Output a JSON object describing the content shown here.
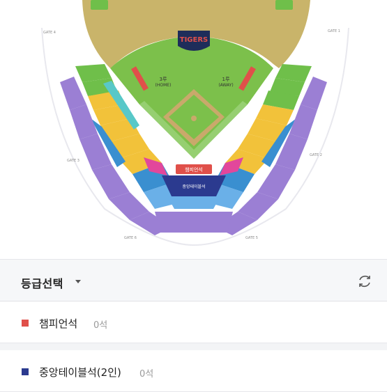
{
  "map": {
    "team_logo_text": "TIGERS",
    "home_label": "3루",
    "home_sub": "(HOME)",
    "away_label": "1루",
    "away_sub": "(AWAY)",
    "champion_label": "챔피언석",
    "central_label": "중앙테이블석",
    "gates": {
      "gate4": "GATE 4",
      "gate1": "GATE 1",
      "gate3": "GATE 3",
      "gate2": "GATE 2",
      "gate6": "GATE 6",
      "gate5": "GATE 5"
    },
    "colors": {
      "field": "#7cc04b",
      "stands": "#c9b46a",
      "outer": "#9b7fd4",
      "blue": "#3a8fd0",
      "yellow": "#f2c23a",
      "green": "#6fbf4a",
      "teal": "#58c8c8",
      "pink": "#e2479b",
      "navy": "#2b3a8f",
      "red": "#e0504a"
    }
  },
  "grade_select": {
    "title": "등급선택",
    "caret_icon": "caret-down-icon",
    "refresh_icon": "refresh-icon"
  },
  "seat_grades": [
    {
      "name": "챔피언석",
      "count": "0석",
      "color": "#e0504a"
    },
    {
      "name": "중앙테이블석(2인)",
      "count": "0석",
      "color": "#2b3a8f"
    }
  ]
}
